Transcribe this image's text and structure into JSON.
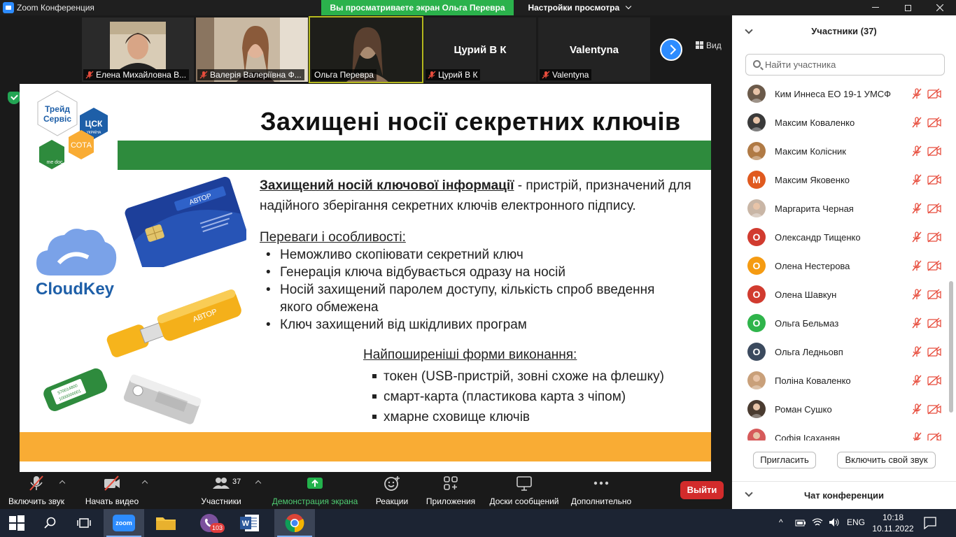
{
  "window": {
    "title": "Zoom Конференция",
    "share_banner": "Вы просматриваете экран Ольга Перевра",
    "view_options": "Настройки просмотра"
  },
  "thumbnails": [
    {
      "name": "Елена Михайловна В...",
      "has_video": true,
      "active": false
    },
    {
      "name": "Валерія Валеріївна Ф...",
      "has_video": true,
      "active": false
    },
    {
      "name": "Ольга Перевра",
      "has_video": true,
      "active": true
    },
    {
      "name": "Цурий В К",
      "big_name": "Цурий В К",
      "has_video": false,
      "active": false
    },
    {
      "name": "Valentyna",
      "big_name": "Valentyna",
      "has_video": false,
      "active": false
    }
  ],
  "view_button": "Вид",
  "slide": {
    "logo_top": "Трейд Сервіс",
    "logo_csk": "ЦСК",
    "logo_csk_sub": "УКРАЇНА",
    "logo_medoc": "me doc",
    "logo_sota": "СОТА",
    "card_brand": "АВТОР",
    "usb_brand": "АВТОР",
    "green_token_text": "570014800 1000000001",
    "title": "Захищені носії секретних ключів",
    "def_term": "Захищений носій ключової інформації",
    "def_line1_rest": " - пристрій, призначений для",
    "def_line2": "надійного зберігання секретних ключів електронного підпису.",
    "features_heading": "Переваги і особливості:",
    "features": [
      "Неможливо скопіювати секретний ключ",
      "Генерація ключа відбувається одразу на носій",
      "Носій захищений паролем доступу, кількість спроб введення",
      "якого обмежена",
      "Ключ захищений від шкідливих програм"
    ],
    "forms_heading": "Найпоширеніші форми виконання:",
    "forms": [
      "токен (USB-пристрій, зовні схоже на флешку)",
      "смарт-карта (пластикова карта з чіпом)",
      "хмарне сховище ключів"
    ],
    "cloudkey": "CloudKey"
  },
  "panel": {
    "title": "Участники (37)",
    "search_placeholder": "Найти участника",
    "participants": [
      {
        "name": "Ким Иннеса ЕО 19-1 УМСФ",
        "initial": "",
        "color": "#6b5a4a",
        "photo": true
      },
      {
        "name": "Максим Коваленко",
        "initial": "",
        "color": "#3a3a3a",
        "photo": true
      },
      {
        "name": "Максим Колісник",
        "initial": "",
        "color": "#b07a45",
        "photo": true
      },
      {
        "name": "Максим Яковенко",
        "initial": "M",
        "color": "#e05a1f",
        "photo": false
      },
      {
        "name": "Маргарита Черная",
        "initial": "",
        "color": "#c9b6a6",
        "photo": true
      },
      {
        "name": "Олександр Тищенко",
        "initial": "O",
        "color": "#d13b2f",
        "photo": false
      },
      {
        "name": "Олена Нестерова",
        "initial": "O",
        "color": "#f59b12",
        "photo": false
      },
      {
        "name": "Олена Шавкун",
        "initial": "O",
        "color": "#d13b2f",
        "photo": false
      },
      {
        "name": "Ольга Бельмаз",
        "initial": "O",
        "color": "#2fb44b",
        "photo": false
      },
      {
        "name": "Ольга Ледньовп",
        "initial": "O",
        "color": "#3b4a5e",
        "photo": false
      },
      {
        "name": "Поліна Коваленко",
        "initial": "",
        "color": "#c9a07a",
        "photo": true
      },
      {
        "name": "Роман Сушко",
        "initial": "",
        "color": "#4a3b30",
        "photo": true
      },
      {
        "name": "Софія Ісаханян",
        "initial": "",
        "color": "#d65a5a",
        "photo": true
      }
    ],
    "invite_button": "Пригласить",
    "unmute_button": "Включить свой звук",
    "chat_title": "Чат конференции"
  },
  "toolbar": {
    "audio": "Включить звук",
    "video": "Начать видео",
    "participants": "Участники",
    "participants_count": "37",
    "share": "Демонстрация экрана",
    "reactions": "Реакции",
    "apps": "Приложения",
    "whiteboards": "Доски сообщений",
    "more": "Дополнительно",
    "leave": "Выйти"
  },
  "taskbar": {
    "viber_badge": "103",
    "lang": "ENG",
    "time": "10:18",
    "date": "10.11.2022"
  }
}
